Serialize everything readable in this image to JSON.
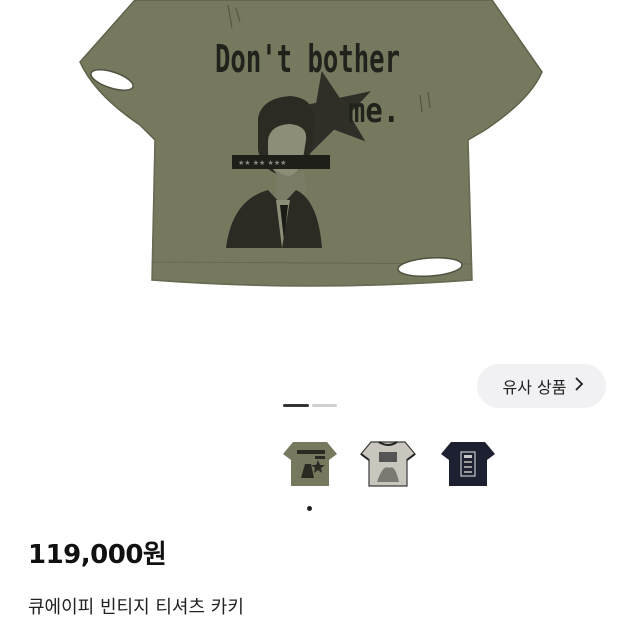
{
  "product": {
    "image_text_line1": "Don't bother",
    "image_text_line2": "me.",
    "price": "119,000원",
    "title": "큐에이피 빈티지 티셔츠 카키",
    "shirt_color": "#77795f"
  },
  "similar_button": {
    "label": "유사 상품",
    "icon": "chevron-right-icon"
  },
  "gallery": {
    "active_index": 0,
    "page_count": 2,
    "thumbnail_count": 3
  },
  "colors": {
    "indicator_active": "#333333",
    "indicator_inactive": "#d0d0d0"
  }
}
